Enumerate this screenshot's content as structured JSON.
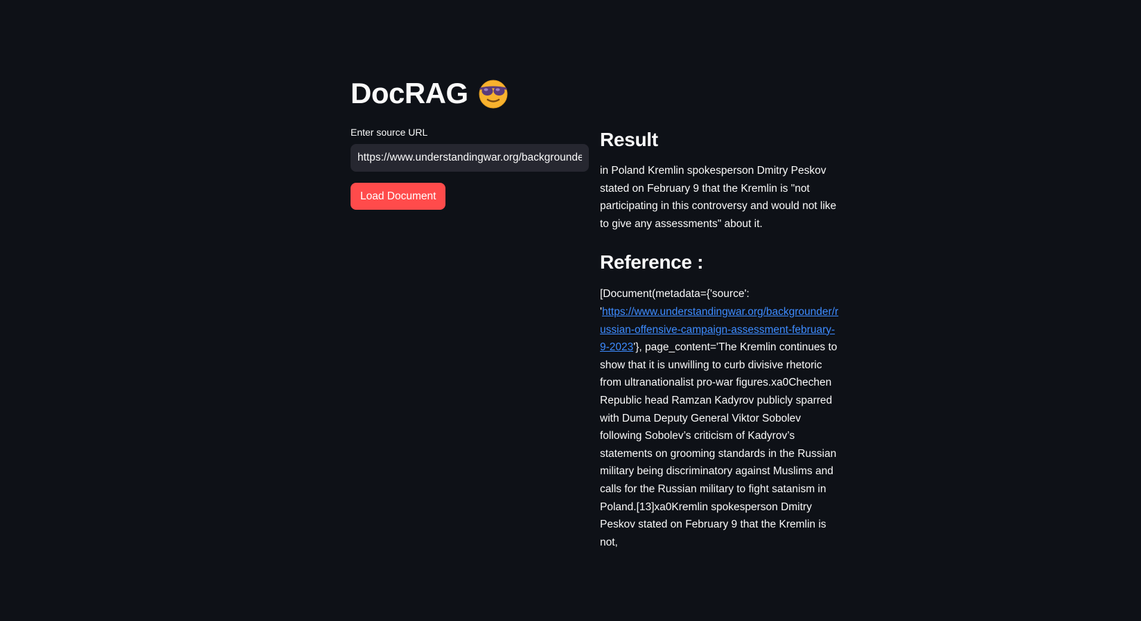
{
  "app": {
    "title": "DocRAG",
    "title_emoji": "😎"
  },
  "source": {
    "label": "Enter source URL",
    "value": "https://www.understandingwar.org/backgrounder/russian-offensive-campaign-assessment-february-9-2023",
    "load_button": "Load Document"
  },
  "result": {
    "heading": "Result",
    "text": "in Poland Kremlin spokesperson Dmitry Peskov stated on February 9 that the Kremlin is \"not participating in this controversy and would not like to give any assessments\" about it."
  },
  "reference": {
    "heading": "Reference :",
    "prefix": "[Document(metadata={'source': '",
    "link": "https://www.understandingwar.org/backgrounder/russian-offensive-campaign-assessment-february-9-2023",
    "suffix": "'}, page_content='The Kremlin continues to show that it is unwilling to curb divisive rhetoric from ultranationalist pro-war figures.xa0Chechen Republic head Ramzan Kadyrov publicly sparred with Duma Deputy General Viktor Sobolev following Sobolev’s criticism of Kadyrov’s statements on grooming standards in the Russian military being discriminatory against Muslims and calls for the Russian military to fight satanism in Poland.[13]xa0Kremlin spokesperson Dmitry Peskov stated on February 9 that the Kremlin is not,"
  },
  "colors": {
    "background": "#0e1117",
    "input_bg": "#262730",
    "primary": "#ff4b4b",
    "link": "#3d8bff",
    "text": "#fafafa"
  }
}
